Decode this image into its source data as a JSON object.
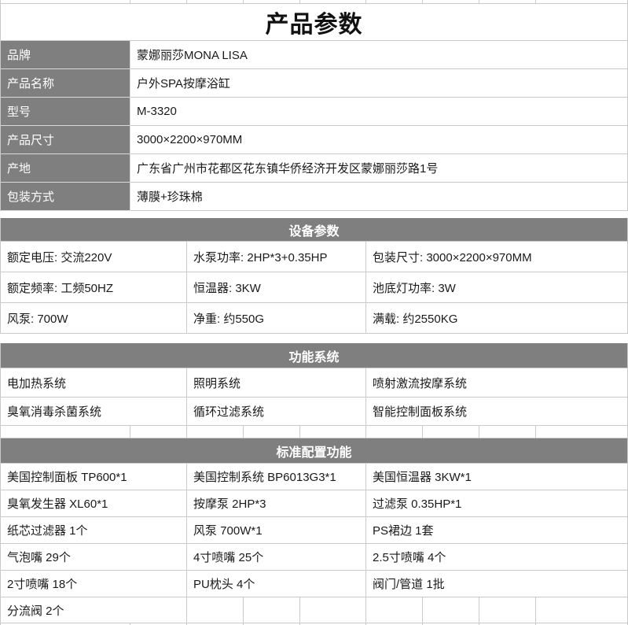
{
  "title": "产品参数",
  "colors": {
    "header_gray": "#7f7f7f",
    "grid_border": "#c9c9c9",
    "text": "#1a1a1a",
    "header_text": "#ffffff"
  },
  "info_rows": [
    {
      "label": "品牌",
      "value": "蒙娜丽莎MONA LISA"
    },
    {
      "label": "产品名称",
      "value": "户外SPA按摩浴缸"
    },
    {
      "label": "型号",
      "value": "M-3320"
    },
    {
      "label": "产品尺寸",
      "value": "3000×2200×970MM"
    },
    {
      "label": "产地",
      "value": "广东省广州市花都区花东镇华侨经济开发区蒙娜丽莎路1号"
    },
    {
      "label": "包装方式",
      "value": "薄膜+珍珠棉"
    }
  ],
  "sections": [
    {
      "header": "设备参数",
      "rows": [
        [
          "额定电压: 交流220V",
          "水泵功率: 2HP*3+0.35HP",
          "包装尺寸: 3000×2200×970MM"
        ],
        [
          "额定频率: 工频50HZ",
          "恒温器: 3KW",
          "池底灯功率: 3W"
        ],
        [
          "风泵: 700W",
          "净重: 约550G",
          "满载: 约2550KG"
        ]
      ]
    },
    {
      "header": "功能系统",
      "rows": [
        [
          "电加热系统",
          "照明系统",
          "喷射激流按摩系统"
        ],
        [
          "臭氧消毒杀菌系统",
          "循环过滤系统",
          "智能控制面板系统"
        ]
      ]
    },
    {
      "header": "标准配置功能",
      "rows": [
        [
          "美国控制面板 TP600*1",
          "美国控制系统 BP6013G3*1",
          "美国恒温器 3KW*1"
        ],
        [
          "臭氧发生器 XL60*1",
          "按摩泵 2HP*3",
          "过滤泵 0.35HP*1"
        ],
        [
          "纸芯过滤器 1个",
          "风泵 700W*1",
          "PS裙边 1套"
        ],
        [
          "气泡嘴 29个",
          "4寸喷嘴 25个",
          "2.5寸喷嘴 4个"
        ],
        [
          "2寸喷嘴 18个",
          "PU枕头 4个",
          "阀门/管道 1批"
        ]
      ],
      "last_row_label": "分流阀 2个"
    }
  ]
}
